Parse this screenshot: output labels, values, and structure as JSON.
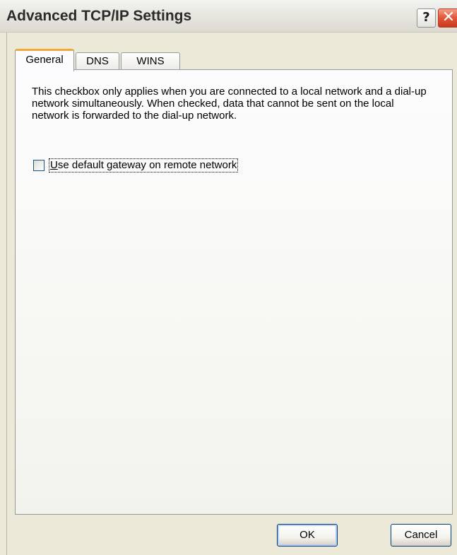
{
  "window": {
    "title": "Advanced TCP/IP Settings",
    "help_label": "?",
    "close_label": "✕"
  },
  "tabs": [
    {
      "label": "General",
      "active": true
    },
    {
      "label": "DNS",
      "active": false
    },
    {
      "label": "WINS",
      "active": false
    }
  ],
  "general": {
    "description": "This checkbox only applies when you are connected to a local network and a dial-up network simultaneously.  When checked, data that cannot be sent on the local network is forwarded to the dial-up network.",
    "checkbox_mnemonic": "U",
    "checkbox_label_rest": "se default gateway on remote network",
    "checkbox_checked": false
  },
  "buttons": {
    "ok_label": "OK",
    "cancel_label": "Cancel"
  },
  "colors": {
    "active_tab_accent": "#f0a83a",
    "close_button": "#e55a3c",
    "dialog_background": "#ece9d8"
  }
}
